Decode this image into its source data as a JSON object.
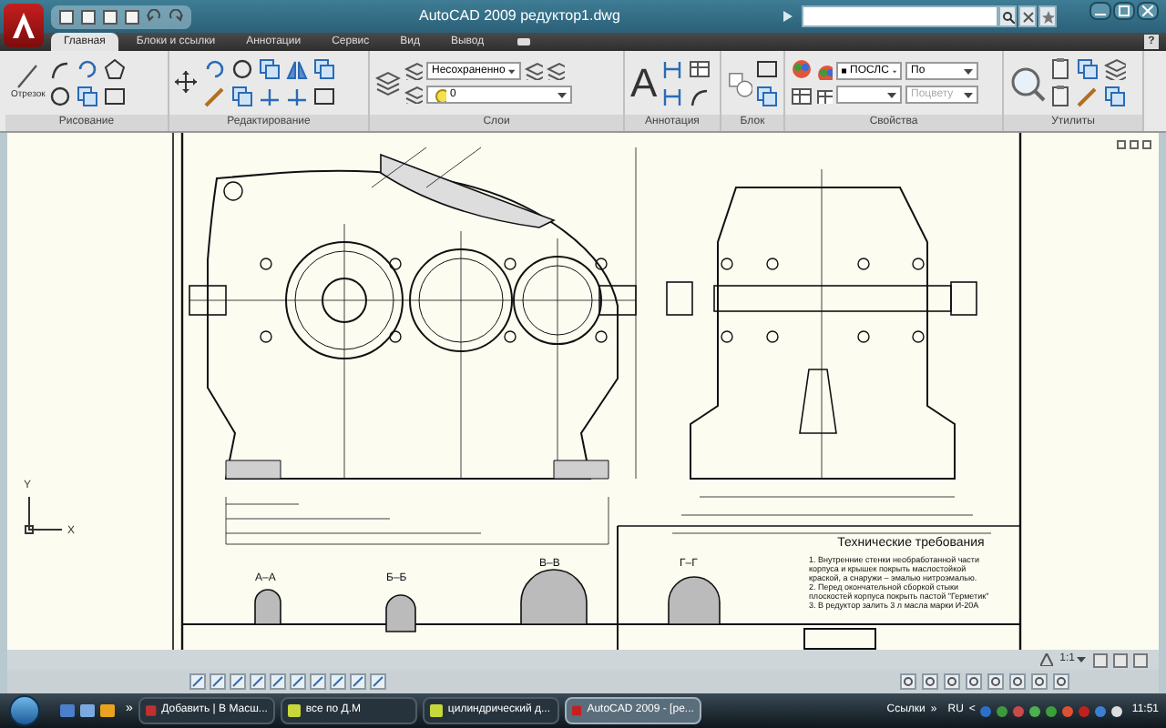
{
  "window": {
    "title": "AutoCAD 2009  редуктор1.dwg"
  },
  "ribbon_tabs": [
    {
      "label": "Главная",
      "selected": true
    },
    {
      "label": "Блоки и ссылки",
      "selected": false
    },
    {
      "label": "Аннотации",
      "selected": false
    },
    {
      "label": "Сервис",
      "selected": false
    },
    {
      "label": "Вид",
      "selected": false
    },
    {
      "label": "Вывод",
      "selected": false
    }
  ],
  "help": "?",
  "panels": [
    {
      "title": "Рисование"
    },
    {
      "title": "Редактирование"
    },
    {
      "title": "Слои"
    },
    {
      "title": "Аннотация"
    },
    {
      "title": "Блок"
    },
    {
      "title": "Свойства"
    },
    {
      "title": "Утилиты"
    }
  ],
  "draw_panel": {
    "line_tool": "Отрезок"
  },
  "layers": {
    "state": "Несохраненно",
    "layer": "0"
  },
  "annotation_panel": {
    "text_tool": "A"
  },
  "properties": {
    "color_setting": "ПОСЛС",
    "linetype": "По",
    "plot_style": {
      "value": "Поцвету",
      "disabled": true
    }
  },
  "drawing": {
    "requirements_title": "Технические требования",
    "requirements": [
      "1. Внутренние стенки необработанной части",
      "корпуса и крышек покрыть маслостойкой",
      "краской, а снаружи – эмалью нитроэмалью.",
      "2. Перед окончательной сборкой стыки",
      "плоскостей корпуса покрыть пастой \"Герметик\"",
      "3. В редуктор залить 3 л масла марки И-20А"
    ],
    "section_labels": [
      "А–А",
      "Б–Б",
      "В–В",
      "Г–Г"
    ],
    "ucs_axes": [
      "Y",
      "X"
    ]
  },
  "annotation_scale": "1:1",
  "taskbar": {
    "chevron": "»",
    "tasks": [
      {
        "label": "Добавить | В Масш...",
        "selected": false
      },
      {
        "label": "все по Д.М",
        "selected": false
      },
      {
        "label": "цилиндрический д...",
        "selected": false
      },
      {
        "label": "AutoCAD 2009 - [ре...",
        "selected": true
      }
    ],
    "links": "Ссылки",
    "links_chevron": "»",
    "language": "RU",
    "tray_arrow": "<",
    "clock": "11:51"
  }
}
